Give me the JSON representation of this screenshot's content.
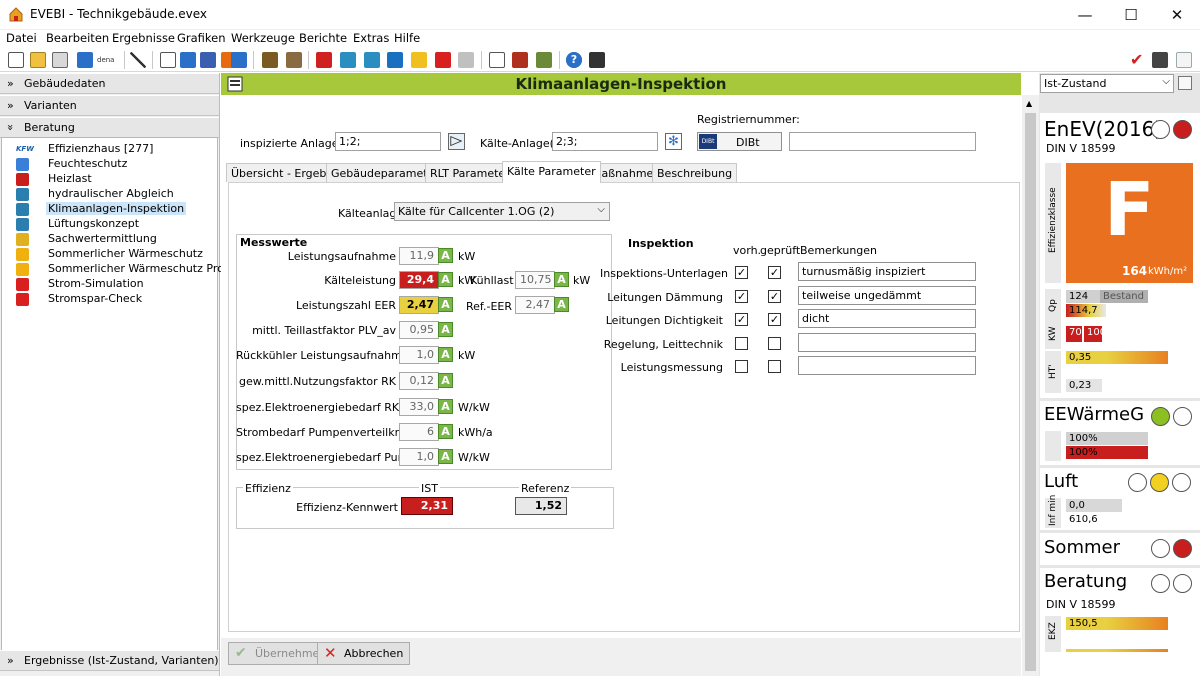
{
  "window": {
    "title": "EVEBI - Technikgebäude.evex",
    "min": "—",
    "max": "☐",
    "close": "✕"
  },
  "menu": [
    "Datei",
    "Bearbeiten",
    "Ergebnisse",
    "Grafiken",
    "Werkzeuge",
    "Berichte",
    "Extras",
    "Hilfe"
  ],
  "toolbar": {
    "dena_label": "dena"
  },
  "left": {
    "gebaeudedaten": "Gebäudedaten",
    "varianten": "Varianten",
    "beratung": "Beratung",
    "ergebnisse": "Ergebnisse (Ist-Zustand, Varianten)",
    "tree": [
      {
        "label": "Effizienzhaus [277]",
        "icon": "kfw-icon",
        "color": "#1d5fa8",
        "badge": "KFW"
      },
      {
        "label": "Feuchteschutz",
        "icon": "drop-icon",
        "color": "#3a7fd8"
      },
      {
        "label": "Heizlast",
        "icon": "heizlast-icon",
        "color": "#c81e1e"
      },
      {
        "label": "hydraulischer Abgleich",
        "icon": "grid-icon",
        "color": "#2a7fb0"
      },
      {
        "label": "Klimaanlagen-Inspektion",
        "icon": "magnifier-icon",
        "color": "#2a7fb0"
      },
      {
        "label": "Lüftungskonzept",
        "icon": "fan-icon",
        "color": "#2a7fb0"
      },
      {
        "label": "Sachwertermittlung",
        "icon": "sun-house-icon",
        "color": "#e0b020"
      },
      {
        "label": "Sommerlicher Wärmeschutz",
        "icon": "sun-icon",
        "color": "#f0b010"
      },
      {
        "label": "Sommerlicher Wärmeschutz Pro",
        "icon": "sun-icon",
        "color": "#f0b010"
      },
      {
        "label": "Strom-Simulation",
        "icon": "lightning-icon",
        "color": "#d82020"
      },
      {
        "label": "Stromspar-Check",
        "icon": "lightning-icon",
        "color": "#d82020"
      }
    ]
  },
  "main": {
    "title": "Klimaanlagen-Inspektion",
    "inspizierte_label": "inspizierte Anlage(n)",
    "inspizierte_value": "1;2;",
    "kaelte_label": "Kälte-Anlage(n)",
    "kaelte_value": "2;3;",
    "registriernummer_label": "Registriernummer:",
    "dibt_label": "DIBt",
    "dibt_logo": "DIBt",
    "registriernummer_value": "",
    "tabs": [
      "Übersicht - Ergebnis",
      "Gebäudeparameter",
      "RLT Parameter",
      "Kälte Parameter",
      "Maßnahmen",
      "Beschreibung"
    ],
    "kaelteanlage_label": "Kälteanlage",
    "kaelteanlage_value": "Kälte für Callcenter 1.OG (2)",
    "messwerte": {
      "title": "Messwerte",
      "rows": [
        {
          "label": "Leistungsaufnahme",
          "value": "11,9",
          "unit": "kW",
          "status": "normal"
        },
        {
          "label": "Kälteleistung",
          "value": "29,4",
          "unit": "kW",
          "status": "red"
        },
        {
          "label": "Leistungszahl EER",
          "value": "2,47",
          "unit": "",
          "status": "yellow"
        },
        {
          "label": "mittl. Teillastfaktor PLV_av",
          "value": "0,95",
          "unit": "",
          "status": "normal"
        },
        {
          "label": "Rückkühler Leistungsaufnahme",
          "value": "1,0",
          "unit": "kW",
          "status": "normal"
        },
        {
          "label": "gew.mittl.Nutzungsfaktor RK",
          "value": "0,12",
          "unit": "",
          "status": "normal"
        },
        {
          "label": "spez.Elektroenergiebedarf RK",
          "value": "33,0",
          "unit": "W/kW",
          "status": "normal"
        },
        {
          "label": "Strombedarf Pumpenverteilkreise",
          "value": "6",
          "unit": "kWh/a",
          "status": "normal"
        },
        {
          "label": "spez.Elektroenergiebedarf Pumpen",
          "value": "1,0",
          "unit": "W/kW",
          "status": "normal"
        }
      ],
      "kuehllast_label": "Kühllast",
      "kuehllast_value": "10,75",
      "kuehllast_unit": "kW",
      "ref_eer_label": "Ref.-EER",
      "ref_eer_value": "2,47",
      "a_label": "A"
    },
    "effizienz": {
      "title": "Effizienz",
      "ist_label": "IST",
      "referenz_label": "Referenz",
      "row_label": "Effizienz-Kennwert",
      "ist_value": "2,31",
      "referenz_value": "1,52"
    },
    "inspektion": {
      "title": "Inspektion",
      "col_vorh": "vorh.",
      "col_geprueft": "geprüft",
      "col_bemerkungen": "Bemerkungen",
      "rows": [
        {
          "label": "Inspektions-Unterlagen",
          "vorh": true,
          "geprueft": true,
          "remark": "turnusmäßig inspiziert"
        },
        {
          "label": "Leitungen Dämmung",
          "vorh": true,
          "geprueft": true,
          "remark": "teilweise ungedämmt"
        },
        {
          "label": "Leitungen Dichtigkeit",
          "vorh": true,
          "geprueft": true,
          "remark": "dicht"
        },
        {
          "label": "Regelung, Leittechnik",
          "vorh": false,
          "geprueft": false,
          "remark": ""
        },
        {
          "label": "Leistungsmessung",
          "vorh": false,
          "geprueft": false,
          "remark": ""
        }
      ]
    },
    "buttons": {
      "uebernehmen": "Übernehmen",
      "abbrechen": "Abbrechen"
    }
  },
  "sidebar": {
    "dropdown": "Ist-Zustand",
    "enev": {
      "title": "EnEV(2016)",
      "subtitle": "DIN V 18599",
      "vlabel": "Effizienzklasse",
      "class": "F",
      "value": "164",
      "unit": "kWh/m²",
      "qp_label": "Qp",
      "qp_ref": "124",
      "qp_ref_label": "Bestand",
      "qp_value": "114,7",
      "kw_label": "KW",
      "kw_1": "70",
      "kw_2": "100",
      "ht_label": "HT'",
      "ht_1": "0,35",
      "ht_2": "0,23"
    },
    "ee": {
      "title": "EEWärmeG",
      "v1": "100%",
      "v2": "100%"
    },
    "luft": {
      "title": "Luft",
      "vlabel": "Inf min",
      "v1": "0,0",
      "v2": "610,6"
    },
    "sommer": {
      "title": "Sommer"
    },
    "beratung": {
      "title": "Beratung",
      "subtitle": "DIN V 18599",
      "vlabel": "EKZ",
      "v1": "150,5"
    }
  },
  "colors": {
    "accent_green": "#a6c83a",
    "class_orange": "#e8701e",
    "red": "#c81e1e",
    "yellow": "#e8d040"
  }
}
